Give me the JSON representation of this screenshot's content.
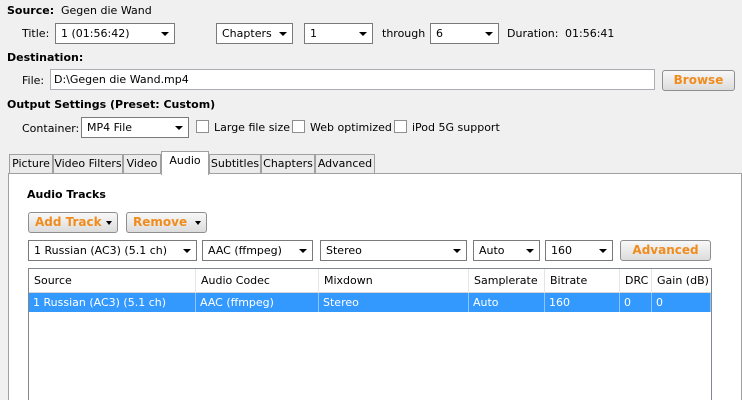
{
  "source": {
    "label": "Source:",
    "name": "Gegen die Wand",
    "title_label": "Title:",
    "title_value": "1 (01:56:42)",
    "range_type": "Chapters",
    "range_start": "1",
    "through_label": "through",
    "range_end": "6",
    "duration_label": "Duration:",
    "duration_value": "01:56:41"
  },
  "destination": {
    "label": "Destination:",
    "file_label": "File:",
    "file_value": "D:\\Gegen die Wand.mp4",
    "browse_label": "Browse"
  },
  "output": {
    "label": "Output Settings (Preset: Custom)",
    "container_label": "Container:",
    "container_value": "MP4 File",
    "large_file_label": "Large file size",
    "web_optimized_label": "Web optimized",
    "ipod_label": "iPod 5G support"
  },
  "tabs": [
    {
      "label": "Picture"
    },
    {
      "label": "Video Filters"
    },
    {
      "label": "Video"
    },
    {
      "label": "Audio"
    },
    {
      "label": "Subtitles"
    },
    {
      "label": "Chapters"
    },
    {
      "label": "Advanced"
    }
  ],
  "audio": {
    "section_title": "Audio Tracks",
    "add_track_label": "Add Track",
    "remove_label": "Remove",
    "track_select": "1 Russian (AC3) (5.1 ch)",
    "codec_select": "AAC (ffmpeg)",
    "mixdown_select": "Stereo",
    "samplerate_select": "Auto",
    "bitrate_select": "160",
    "advanced_label": "Advanced",
    "columns": [
      "Source",
      "Audio Codec",
      "Mixdown",
      "Samplerate",
      "Bitrate",
      "DRC",
      "Gain (dB)"
    ],
    "rows": [
      {
        "source": "1 Russian (AC3) (5.1 ch)",
        "codec": "AAC (ffmpeg)",
        "mixdown": "Stereo",
        "samplerate": "Auto",
        "bitrate": "160",
        "drc": "0",
        "gain": "0"
      }
    ]
  }
}
